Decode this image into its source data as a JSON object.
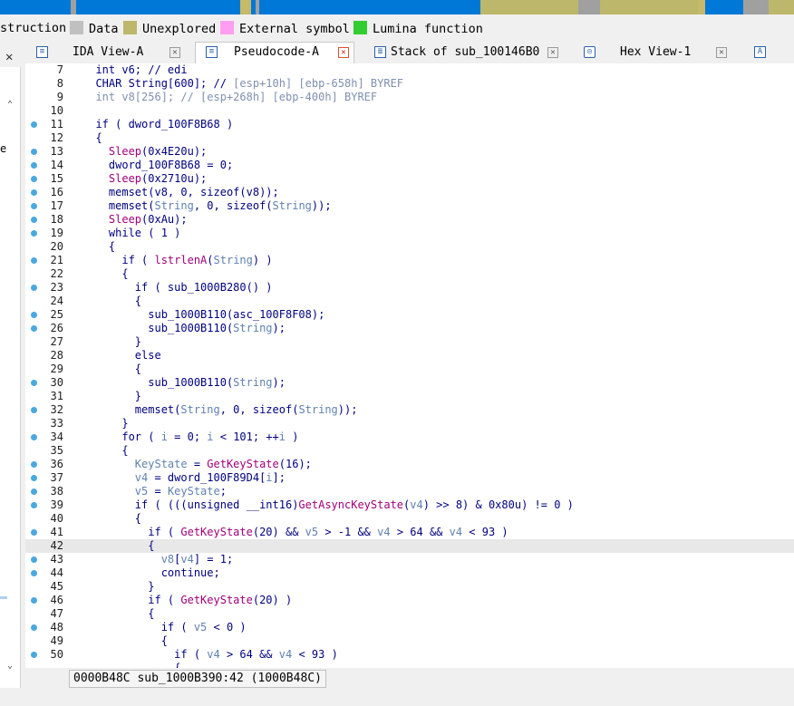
{
  "navband_colors": [
    "#0078d7",
    "#a0a0a0",
    "#c7b86a",
    "#2bbd4a",
    "#ff8080"
  ],
  "legend": [
    {
      "label": "struction",
      "color": null
    },
    {
      "label": "Data",
      "color": "#c0c0c0"
    },
    {
      "label": "Unexplored",
      "color": "#bdb76b"
    },
    {
      "label": "External symbol",
      "color": "#ff9ef0"
    },
    {
      "label": "Lumina function",
      "color": "#33cc33"
    }
  ],
  "left_panel": {
    "close_icon": "close-icon",
    "fragment": "e"
  },
  "tabs": [
    {
      "label": "IDA View-A",
      "icon": "listing-icon",
      "active": false
    },
    {
      "label": "Pseudocode-A",
      "icon": "pseudocode-icon",
      "active": true
    },
    {
      "label": "Stack of sub_100146B0",
      "icon": "stack-icon",
      "active": false
    },
    {
      "label": "Hex View-1",
      "icon": "hex-icon",
      "active": false
    },
    {
      "label": "",
      "icon": "structures-icon",
      "active": false
    }
  ],
  "code_lines": [
    {
      "n": "7",
      "bp": false,
      "html": "  <span class='c-var'>int v6; // edi</span>"
    },
    {
      "n": "8",
      "bp": false,
      "html": "  CHAR String[600]; // <span class='c-cmt'>[esp+10h] [ebp-658h] BYREF</span>"
    },
    {
      "n": "9",
      "bp": false,
      "html": "  <span class='c-cmt'>int v8[256]; // [esp+268h] [ebp-400h] BYREF</span>"
    },
    {
      "n": "10",
      "bp": false,
      "html": ""
    },
    {
      "n": "11",
      "bp": true,
      "html": "  if ( dword_100F8B68 )"
    },
    {
      "n": "12",
      "bp": false,
      "html": "  {"
    },
    {
      "n": "13",
      "bp": true,
      "html": "    <span class='c-func'>Sleep</span>(0x4E20u);"
    },
    {
      "n": "14",
      "bp": true,
      "html": "    dword_100F8B68 = 0;"
    },
    {
      "n": "15",
      "bp": true,
      "html": "    <span class='c-func'>Sleep</span>(0x2710u);"
    },
    {
      "n": "16",
      "bp": true,
      "html": "    memset(v8, 0, sizeof(v8));"
    },
    {
      "n": "17",
      "bp": true,
      "html": "    memset(<span class='c-str'>String</span>, 0, sizeof(<span class='c-str'>String</span>));"
    },
    {
      "n": "18",
      "bp": true,
      "html": "    <span class='c-func'>Sleep</span>(0xAu);"
    },
    {
      "n": "19",
      "bp": true,
      "html": "    while ( 1 )"
    },
    {
      "n": "20",
      "bp": false,
      "html": "    {"
    },
    {
      "n": "21",
      "bp": true,
      "html": "      if ( <span class='c-func'>lstrlenA</span>(<span class='c-str'>String</span>) )"
    },
    {
      "n": "22",
      "bp": false,
      "html": "      {"
    },
    {
      "n": "23",
      "bp": true,
      "html": "        if ( sub_1000B280() )"
    },
    {
      "n": "24",
      "bp": false,
      "html": "        {"
    },
    {
      "n": "25",
      "bp": true,
      "html": "          sub_1000B110(asc_100F8F08);"
    },
    {
      "n": "26",
      "bp": true,
      "html": "          sub_1000B110(<span class='c-str'>String</span>);"
    },
    {
      "n": "27",
      "bp": false,
      "html": "        }"
    },
    {
      "n": "28",
      "bp": false,
      "html": "        else"
    },
    {
      "n": "29",
      "bp": false,
      "html": "        {"
    },
    {
      "n": "30",
      "bp": true,
      "html": "          sub_1000B110(<span class='c-str'>String</span>);"
    },
    {
      "n": "31",
      "bp": false,
      "html": "        }"
    },
    {
      "n": "32",
      "bp": true,
      "html": "        memset(<span class='c-str'>String</span>, 0, sizeof(<span class='c-str'>String</span>));"
    },
    {
      "n": "33",
      "bp": false,
      "html": "      }"
    },
    {
      "n": "34",
      "bp": true,
      "html": "      for ( <span class='c-str'>i</span> = 0; <span class='c-str'>i</span> &lt; 101; ++<span class='c-str'>i</span> )"
    },
    {
      "n": "35",
      "bp": false,
      "html": "      {"
    },
    {
      "n": "36",
      "bp": true,
      "html": "        <span class='c-str'>KeyState</span> = <span class='c-func'>GetKeyState</span>(16);"
    },
    {
      "n": "37",
      "bp": true,
      "html": "        <span class='c-str'>v4</span> = dword_100F89D4[<span class='c-str'>i</span>];"
    },
    {
      "n": "38",
      "bp": true,
      "html": "        <span class='c-str'>v5</span> = <span class='c-str'>KeyState</span>;"
    },
    {
      "n": "39",
      "bp": true,
      "html": "        if ( (((unsigned __int16)<span class='c-func'>GetAsyncKeyState</span>(<span class='c-str'>v4</span>) &gt;&gt; 8) &amp; 0x80u) != 0 )"
    },
    {
      "n": "40",
      "bp": false,
      "html": "        {"
    },
    {
      "n": "41",
      "bp": true,
      "html": "          if ( <span class='c-func'>GetKeyState</span>(20) &amp;&amp; <span class='c-str'>v5</span> &gt; -1 &amp;&amp; <span class='c-str'>v4</span> &gt; 64 &amp;&amp; <span class='c-str'>v4</span> &lt; 93 )"
    },
    {
      "n": "42",
      "bp": false,
      "html": "          {",
      "current": true
    },
    {
      "n": "43",
      "bp": true,
      "html": "            <span class='c-str'>v8</span>[<span class='c-str'>v4</span>] = 1;"
    },
    {
      "n": "44",
      "bp": true,
      "html": "            continue;"
    },
    {
      "n": "45",
      "bp": false,
      "html": "          }"
    },
    {
      "n": "46",
      "bp": true,
      "html": "          if ( <span class='c-func'>GetKeyState</span>(20) )"
    },
    {
      "n": "47",
      "bp": false,
      "html": "          {"
    },
    {
      "n": "48",
      "bp": true,
      "html": "            if ( <span class='c-str'>v5</span> &lt; 0 )"
    },
    {
      "n": "49",
      "bp": false,
      "html": "            {"
    },
    {
      "n": "50",
      "bp": true,
      "html": "              if ( <span class='c-str'>v4</span> &gt; 64 &amp;&amp; <span class='c-str'>v4</span> &lt; 93 )"
    },
    {
      "n": "",
      "bp": false,
      "html": "              {"
    }
  ],
  "status": {
    "text": "0000B48C sub_1000B390:42 (1000B48C)"
  }
}
